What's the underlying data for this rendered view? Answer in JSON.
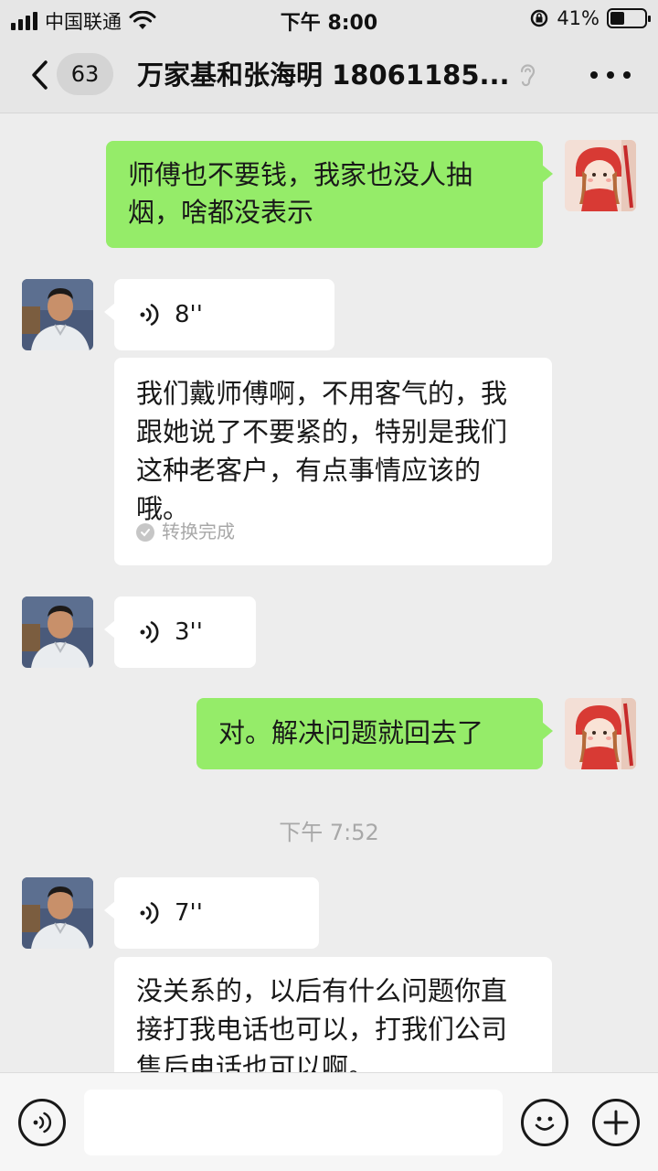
{
  "status_bar": {
    "carrier": "中国联通",
    "time": "下午 8:00",
    "battery_percent_label": "41%",
    "battery_level": 0.41
  },
  "nav": {
    "unread_count": "63",
    "chat_title": "万家基和张海明 18061185..."
  },
  "messages": [
    {
      "side": "right",
      "type": "text",
      "text": "师傅也不要钱，我家也没人抽烟，啥都没表示"
    },
    {
      "side": "left",
      "type": "voice",
      "duration": "8''"
    },
    {
      "side": "left",
      "type": "transcript",
      "text": "我们戴师傅啊，不用客气的，我跟她说了不要紧的，特别是我们这种老客户，有点事情应该的哦。",
      "status": "转换完成"
    },
    {
      "side": "left",
      "type": "voice",
      "duration": "3''"
    },
    {
      "side": "right",
      "type": "text",
      "text": "对。解决问题就回去了"
    },
    {
      "side": "left",
      "type": "voice",
      "duration": "7''"
    },
    {
      "side": "left",
      "type": "transcript",
      "text": "没关系的，以后有什么问题你直接打我电话也可以，打我们公司售后电话也可以啊。"
    }
  ],
  "timestamp": "下午 7:52",
  "input": {
    "value": "",
    "placeholder": ""
  },
  "icons": {
    "back": "chevron-left-icon",
    "ear": "ear-icon",
    "more": "more-icon",
    "voice_toggle": "voice-icon",
    "emoji": "emoji-icon",
    "add": "plus-icon"
  },
  "colors": {
    "sent_bubble": "#95ec69",
    "received_bubble": "#ffffff",
    "background": "#ededed"
  }
}
